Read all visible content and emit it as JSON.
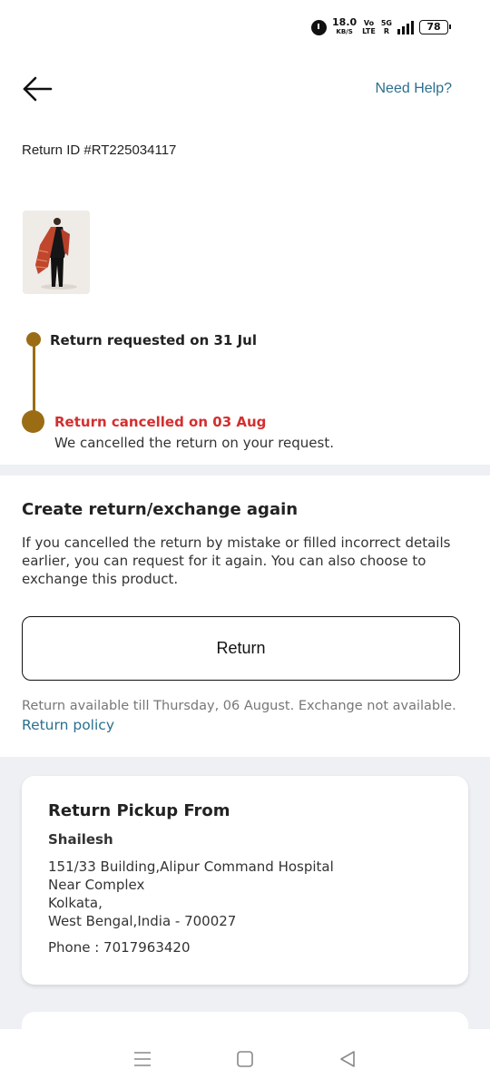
{
  "status_bar": {
    "speed_value": "18.0",
    "speed_unit": "KB/S",
    "volte_top": "Vo",
    "volte_bottom": "LTE",
    "network_top": "5G",
    "network_bottom": "R",
    "battery": "78"
  },
  "header": {
    "help_label": "Need Help?"
  },
  "return_id": "Return ID #RT225034117",
  "timeline": {
    "steps": [
      {
        "label": "Return requested on 31 Jul"
      },
      {
        "label": "Return cancelled on 03 Aug",
        "description": "We cancelled the return on your request."
      }
    ],
    "line_color": "#9a6d15",
    "cancel_color": "#d32f2f"
  },
  "again": {
    "title": "Create return/exchange again",
    "description": "If you cancelled the return by mistake or filled incorrect details earlier, you can request for it again. You can also choose to exchange this product.",
    "button_label": "Return",
    "availability_note": "Return available till Thursday, 06 August. Exchange not available.",
    "policy_link": "Return policy"
  },
  "pickup": {
    "title": "Return Pickup From",
    "name": "Shailesh",
    "address_lines": [
      "151/33 Building,Alipur Command Hospital",
      "Near Complex",
      "Kolkata,",
      "West Bengal,India - 700027"
    ],
    "phone": "Phone : 7017963420"
  },
  "icons": {
    "back": "arrow-left-icon",
    "nav_menu": "menu-icon",
    "nav_home": "home-square-icon",
    "nav_back": "triangle-back-icon"
  },
  "colors": {
    "link": "#2b6f8f",
    "accent": "#9a6d15",
    "cancel": "#d32f2f",
    "section_bg": "#eef0f3"
  }
}
